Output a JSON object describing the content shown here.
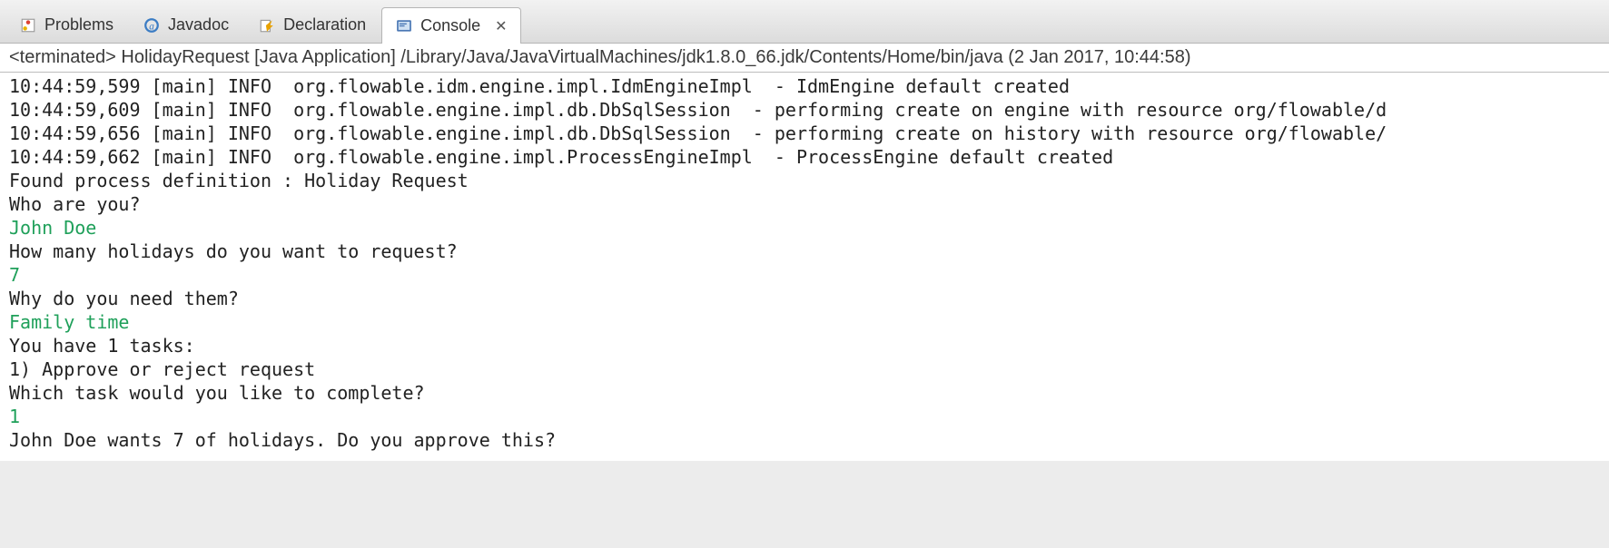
{
  "tabs": {
    "problems": "Problems",
    "javadoc": "Javadoc",
    "declaration": "Declaration",
    "console": "Console"
  },
  "status": "<terminated> HolidayRequest [Java Application] /Library/Java/JavaVirtualMachines/jdk1.8.0_66.jdk/Contents/Home/bin/java (2 Jan 2017, 10:44:58)",
  "console": {
    "lines": [
      {
        "text": "10:44:59,599 [main] INFO  org.flowable.idm.engine.impl.IdmEngineImpl  - IdmEngine default created",
        "input": false
      },
      {
        "text": "10:44:59,609 [main] INFO  org.flowable.engine.impl.db.DbSqlSession  - performing create on engine with resource org/flowable/d",
        "input": false
      },
      {
        "text": "10:44:59,656 [main] INFO  org.flowable.engine.impl.db.DbSqlSession  - performing create on history with resource org/flowable/",
        "input": false
      },
      {
        "text": "10:44:59,662 [main] INFO  org.flowable.engine.impl.ProcessEngineImpl  - ProcessEngine default created",
        "input": false
      },
      {
        "text": "Found process definition : Holiday Request",
        "input": false
      },
      {
        "text": "Who are you?",
        "input": false
      },
      {
        "text": "John Doe",
        "input": true
      },
      {
        "text": "How many holidays do you want to request?",
        "input": false
      },
      {
        "text": "7",
        "input": true
      },
      {
        "text": "Why do you need them?",
        "input": false
      },
      {
        "text": "Family time",
        "input": true
      },
      {
        "text": "You have 1 tasks:",
        "input": false
      },
      {
        "text": "1) Approve or reject request",
        "input": false
      },
      {
        "text": "Which task would you like to complete?",
        "input": false
      },
      {
        "text": "1",
        "input": true
      },
      {
        "text": "John Doe wants 7 of holidays. Do you approve this?",
        "input": false
      }
    ]
  }
}
